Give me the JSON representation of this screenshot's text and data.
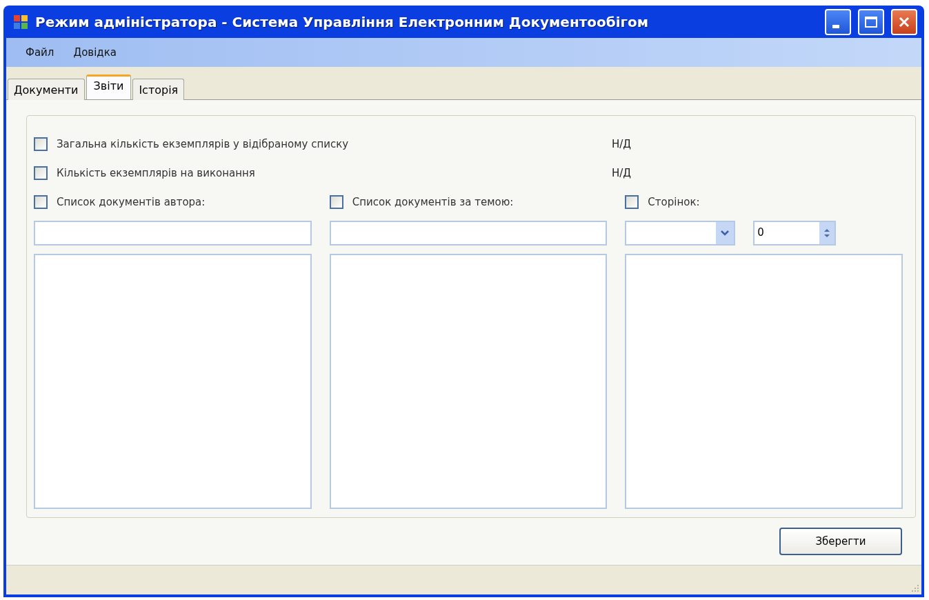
{
  "window": {
    "title": "Режим  адміністратора - Система Управління Електронним Документообігом"
  },
  "menu": [
    {
      "label": "Файл"
    },
    {
      "label": "Довідка"
    }
  ],
  "tabs": [
    {
      "label": "Документи",
      "selected": false
    },
    {
      "label": "Звіти",
      "selected": true
    },
    {
      "label": "Історія",
      "selected": false
    }
  ],
  "totals": [
    {
      "label": "Загальна кількість екземплярів у відібраному списку",
      "checked": false,
      "value": "Н/Д"
    },
    {
      "label": "Кількість екземплярів на виконання",
      "checked": false,
      "value": "Н/Д"
    }
  ],
  "columns": [
    {
      "kind": "text",
      "label": "Список документів автора:",
      "checked": false
    },
    {
      "kind": "text",
      "label": "Список документів за темою:",
      "checked": false
    },
    {
      "kind": "pages",
      "label": "Сторінок:",
      "checked": false,
      "spinner_value": "0"
    }
  ],
  "buttons": [
    {
      "label": "Зберегти"
    }
  ]
}
